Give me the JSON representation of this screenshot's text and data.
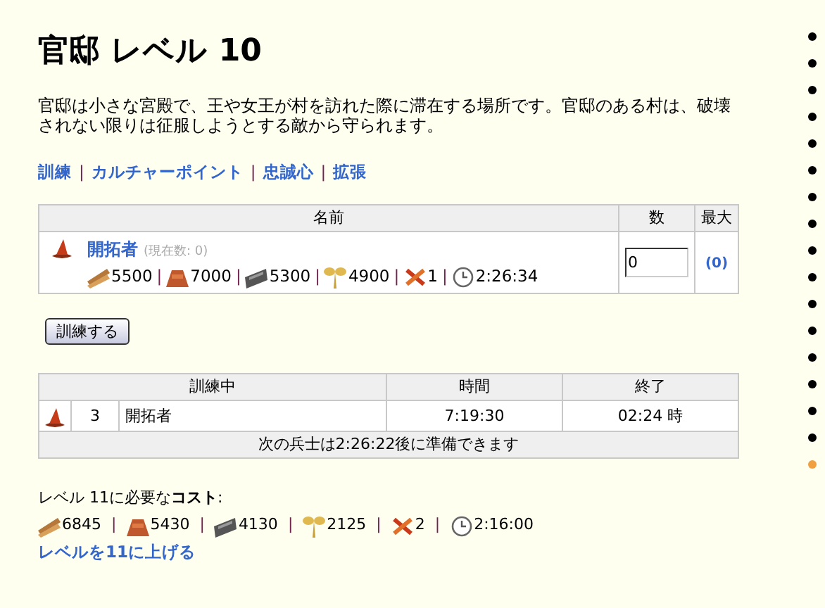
{
  "title": "官邸 レベル 10",
  "description": "官邸は小さな宮殿で、王や女王が村を訪れた際に滞在する場所です。官邸のある村は、破壊されない限りは征服しようとする敵から守られます。",
  "nav_links": [
    "訓練",
    "カルチャーポイント",
    "忠誠心",
    "拡張"
  ],
  "separator": "|",
  "train_table": {
    "columns": [
      "名前",
      "数",
      "最大"
    ],
    "rows": [
      {
        "name": "開拓者",
        "current": "(現在数: 0)",
        "costs": [
          {
            "kind": "wood",
            "value": "5500"
          },
          {
            "kind": "clay",
            "value": "7000"
          },
          {
            "kind": "iron",
            "value": "5300"
          },
          {
            "kind": "crop",
            "value": "4900"
          },
          {
            "kind": "upkeep",
            "value": "1"
          },
          {
            "kind": "time",
            "value": "2:26:34"
          }
        ],
        "amount": "0",
        "max": "(0)"
      }
    ]
  },
  "train_button": "訓練する",
  "queue_table": {
    "columns": [
      "訓練中",
      "時間",
      "終了"
    ],
    "rows": [
      {
        "count": "3",
        "name": "開拓者",
        "duration": "7:19:30",
        "finish": "02:24 時"
      }
    ],
    "footer": "次の兵士は2:26:22後に準備できます"
  },
  "upgrade_cost": {
    "label": "レベル 11に必要な**コスト**:",
    "costs": [
      {
        "kind": "wood",
        "value": "6845"
      },
      {
        "kind": "clay",
        "value": "5430"
      },
      {
        "kind": "iron",
        "value": "4130"
      },
      {
        "kind": "crop",
        "value": "2125"
      },
      {
        "kind": "upkeep",
        "value": "2"
      },
      {
        "kind": "time",
        "value": "2:16:00"
      }
    ]
  },
  "upgrade_link": "レベルを11に上げる",
  "side_markers": [
    {
      "selected": false
    },
    {
      "selected": false
    },
    {
      "selected": false
    },
    {
      "selected": false
    },
    {
      "selected": false
    },
    {
      "selected": false
    },
    {
      "selected": false
    },
    {
      "selected": false
    },
    {
      "selected": false
    },
    {
      "selected": false
    },
    {
      "selected": false
    },
    {
      "selected": false
    },
    {
      "selected": false
    },
    {
      "selected": false
    },
    {
      "selected": false
    },
    {
      "selected": false
    },
    {
      "selected": true
    }
  ]
}
